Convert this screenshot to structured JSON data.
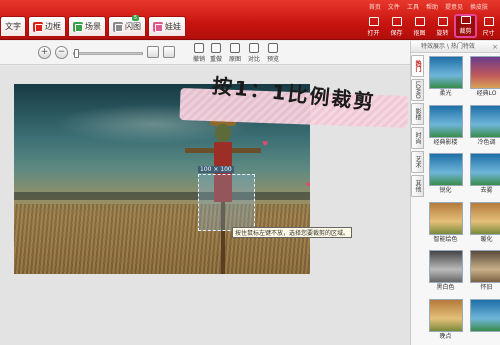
{
  "top_menu": [
    "首页",
    "文件",
    "工具",
    "帮助",
    "提意见",
    "换皮肤"
  ],
  "tabs": [
    {
      "label": "文字",
      "icon": "text-icon"
    },
    {
      "label": "边框",
      "icon": "frame-icon"
    },
    {
      "label": "场景",
      "icon": "scene-icon"
    },
    {
      "label": "闪图",
      "icon": "flash-icon",
      "badge": "5"
    },
    {
      "label": "娃娃",
      "icon": "doll-icon"
    }
  ],
  "tools": [
    {
      "label": "打开",
      "icon": "open-icon"
    },
    {
      "label": "保存",
      "icon": "save-icon"
    },
    {
      "label": "抠图",
      "icon": "cutout-icon"
    },
    {
      "label": "旋转",
      "icon": "rotate-icon"
    },
    {
      "label": "裁剪",
      "icon": "crop-icon"
    },
    {
      "label": "尺寸",
      "icon": "resize-icon"
    }
  ],
  "toolbar": {
    "zoom_in": "+",
    "zoom_out": "−",
    "actions": [
      {
        "label": "撤销",
        "icon": "undo-icon"
      },
      {
        "label": "重做",
        "icon": "redo-icon"
      },
      {
        "label": "原图",
        "icon": "original-icon"
      },
      {
        "label": "对比",
        "icon": "compare-icon"
      },
      {
        "label": "预览",
        "icon": "preview-icon"
      }
    ]
  },
  "canvas": {
    "banner": "按1：1比例裁剪",
    "crop_label": "100 × 100",
    "tooltip": "按住鼠标左键不放，选择您要裁剪的区域。"
  },
  "panel": {
    "title": "特效展示 \\ 热门特效",
    "vtabs": [
      "热门",
      "LOMO",
      "影楼",
      "时尚",
      "艺术",
      "其他"
    ],
    "effects": [
      {
        "label": "柔光",
        "style": "blue"
      },
      {
        "label": "经典LO",
        "style": "red"
      },
      {
        "label": "经典影楼",
        "style": "blue"
      },
      {
        "label": "冷色调",
        "style": "blue"
      },
      {
        "label": "锐化",
        "style": "blue"
      },
      {
        "label": "去雾",
        "style": "blue"
      },
      {
        "label": "智能绘色",
        "style": "warm"
      },
      {
        "label": "暖化",
        "style": "warm"
      },
      {
        "label": "黑白色",
        "style": "bw"
      },
      {
        "label": "怀旧",
        "style": "sepia"
      },
      {
        "label": "晚点",
        "style": "warm"
      },
      {
        "label": "",
        "style": "blue"
      }
    ]
  }
}
